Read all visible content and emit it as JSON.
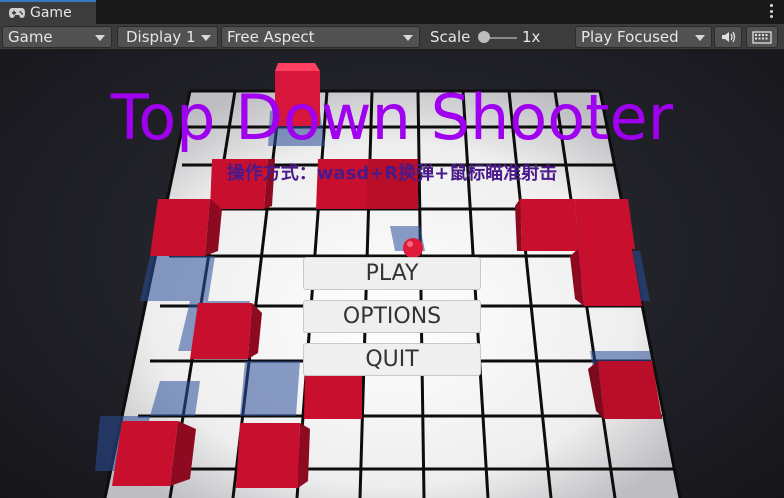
{
  "tabbar": {
    "tab_label": "Game"
  },
  "toolbar": {
    "mode": "Game",
    "display": "Display 1",
    "aspect": "Free Aspect",
    "scale_label": "Scale",
    "scale_value": "1x",
    "play_mode": "Play Focused"
  },
  "game": {
    "title": "Top Down Shooter",
    "subtitle": "操作方式：wasd+R换弹+鼠标瞄准射击",
    "buttons": {
      "play": "PLAY",
      "options": "OPTIONS",
      "quit": "QUIT"
    }
  },
  "colors": {
    "title": "#a000f0",
    "block_red": "#c8102e",
    "floor": "#f4f4f4",
    "grid_line": "#111111"
  }
}
